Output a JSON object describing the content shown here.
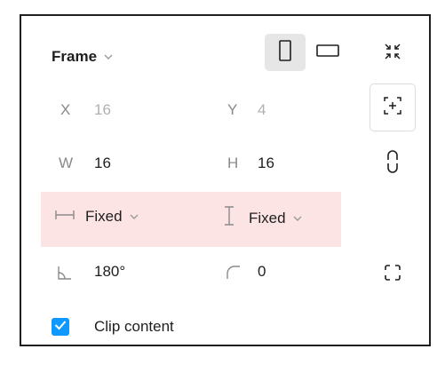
{
  "frame": {
    "title": "Frame",
    "orientation": {
      "portrait_selected": true
    }
  },
  "position": {
    "x_label": "X",
    "x_value": "16",
    "y_label": "Y",
    "y_value": "4"
  },
  "size": {
    "w_label": "W",
    "w_value": "16",
    "h_label": "H",
    "h_value": "16"
  },
  "resizing": {
    "horizontal": "Fixed",
    "vertical": "Fixed",
    "highlight_color": "#fde4e4"
  },
  "transform": {
    "rotation": "180°",
    "corner_radius": "0"
  },
  "clip": {
    "label": "Clip content",
    "checked": true,
    "accent": "#0d99ff"
  },
  "icons": {
    "orientation_portrait": "portrait-frame-icon",
    "orientation_landscape": "landscape-frame-icon",
    "collapse": "collapse-arrows-icon",
    "add_to_frame": "add-to-frame-icon",
    "constrain_proportions": "link-icon",
    "resize_horizontal": "horizontal-resize-icon",
    "resize_vertical": "vertical-resize-icon",
    "rotation": "angle-icon",
    "radius": "corner-radius-icon",
    "independent_corners": "independent-corners-icon",
    "checkbox": "check-icon"
  }
}
